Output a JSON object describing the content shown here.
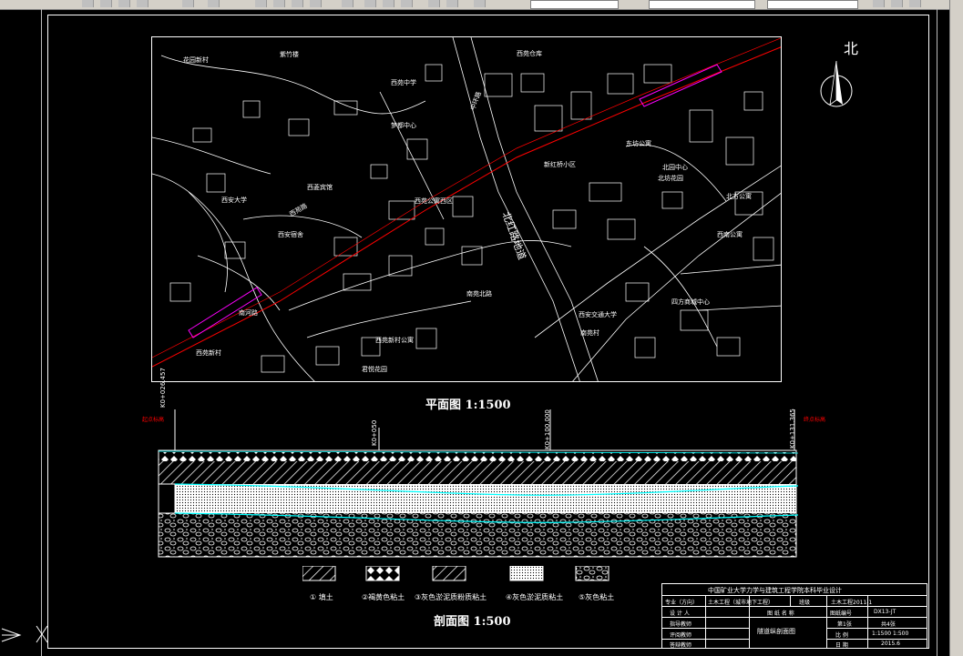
{
  "toolbar": {
    "combo_1": "",
    "combo_2": "",
    "combo_3": ""
  },
  "plan": {
    "north_label": "北",
    "title": "平面图  1:1500",
    "map_labels": [
      "花园新村",
      "紫竹楼",
      "西苑中学",
      "西苑仓库",
      "梦都中心",
      "西菱宾馆",
      "西安大学",
      "西安宿舍",
      "西苑公寓西区",
      "北坊花园",
      "新红桥小区",
      "东坊公寓",
      "北园中心",
      "中环路",
      "北红路地道",
      "西安交通大学",
      "南苑村",
      "南河路",
      "西苑路",
      "西苑新村",
      "南苑北路",
      "西苑新村公寓",
      "君悦花园",
      "西南公寓",
      "北方公寓",
      "四方商城中心"
    ]
  },
  "profile": {
    "title": "剖面图  1:500",
    "stations": [
      "K0+026.457",
      "K0+050",
      "K0+100.000",
      "K0+131.365"
    ],
    "marks_left": "起点标高",
    "marks_right": "终点标高"
  },
  "legend": [
    {
      "label": "① 填土"
    },
    {
      "label": "②褐黄色粘土"
    },
    {
      "label": "③灰色淤泥质粉质粘土"
    },
    {
      "label": "④灰色淤泥质粘土"
    },
    {
      "label": "⑤灰色粘土"
    }
  ],
  "title_block": {
    "school": "中国矿业大学力学与建筑工程学院本科毕业设计",
    "major_label": "专业（方向）",
    "major_value": "土木工程（城市地下工程）",
    "class_label": "班级",
    "class_value": "土木工程2011-1",
    "student_label": "设 计 人",
    "drawing_name_label": "图 纸 名 称",
    "drawing_no_label": "图纸编号",
    "drawing_no_value": "DX13-JT",
    "advisor_label": "指导教师",
    "drawing_name_value": "隧道纵剖面图",
    "sheet_label": "第1张",
    "total_label": "共4张",
    "reviewer_label": "评阅教师",
    "scale_label": "比  例",
    "scale_value": "1:1500  1:500",
    "date_label": "日  期",
    "date_value": "2015.6",
    "defense_label": "答辩教师"
  },
  "colors": {
    "background": "#000000",
    "lines": "#ffffff",
    "route": "#ff0000",
    "route_tunnel": "#ff00ff",
    "water": "#00ffff"
  }
}
